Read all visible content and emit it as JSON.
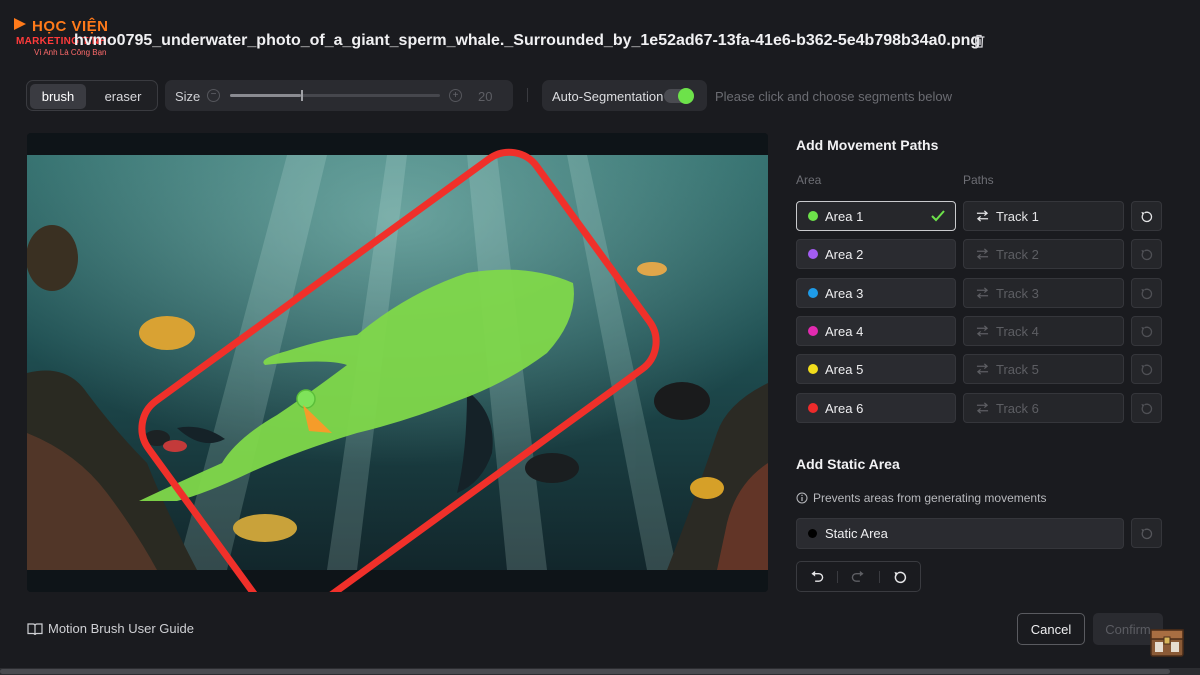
{
  "logo": {
    "line1": "HỌC VIỆN",
    "line2": "MARKETING TINH",
    "line3": "Vì Anh Là Công Bạn"
  },
  "header": {
    "file_title": "hvmo0795_underwater_photo_of_a_giant_sperm_whale._Surrounded_by_1e52ad67-13fa-41e6-b362-5e4b798b34a0.png",
    "delete_icon": "trash-icon"
  },
  "toolbar": {
    "brush_label": "brush",
    "eraser_label": "eraser",
    "size_label": "Size",
    "size_value": "20",
    "size_level_fraction": 0.34,
    "autoseg_label": "Auto-Segmentation",
    "autoseg_on": true,
    "hint": "Please click and choose segments below"
  },
  "panel": {
    "paths_title": "Add Movement Paths",
    "col_area": "Area",
    "col_paths": "Paths",
    "areas": [
      {
        "label": "Area 1",
        "color": "#6de24a",
        "selected": true,
        "track": "Track 1",
        "track_enabled": true
      },
      {
        "label": "Area 2",
        "color": "#a35cf2",
        "selected": false,
        "track": "Track 2",
        "track_enabled": false
      },
      {
        "label": "Area 3",
        "color": "#1e9be8",
        "selected": false,
        "track": "Track 3",
        "track_enabled": false
      },
      {
        "label": "Area 4",
        "color": "#e22ab0",
        "selected": false,
        "track": "Track 4",
        "track_enabled": false
      },
      {
        "label": "Area 5",
        "color": "#f2dd1c",
        "selected": false,
        "track": "Track 5",
        "track_enabled": false
      },
      {
        "label": "Area 6",
        "color": "#ee2b2b",
        "selected": false,
        "track": "Track 6",
        "track_enabled": false
      }
    ],
    "static_title": "Add Static Area",
    "static_note": "Prevents areas from generating movements",
    "static_label": "Static Area"
  },
  "footer": {
    "guide_label": "Motion Brush User Guide",
    "cancel_label": "Cancel",
    "confirm_label": "Confirm"
  },
  "colors": {
    "accent_green": "#6de24a",
    "annotation_red": "#f0302a",
    "arrow_orange": "#f59c2a"
  }
}
